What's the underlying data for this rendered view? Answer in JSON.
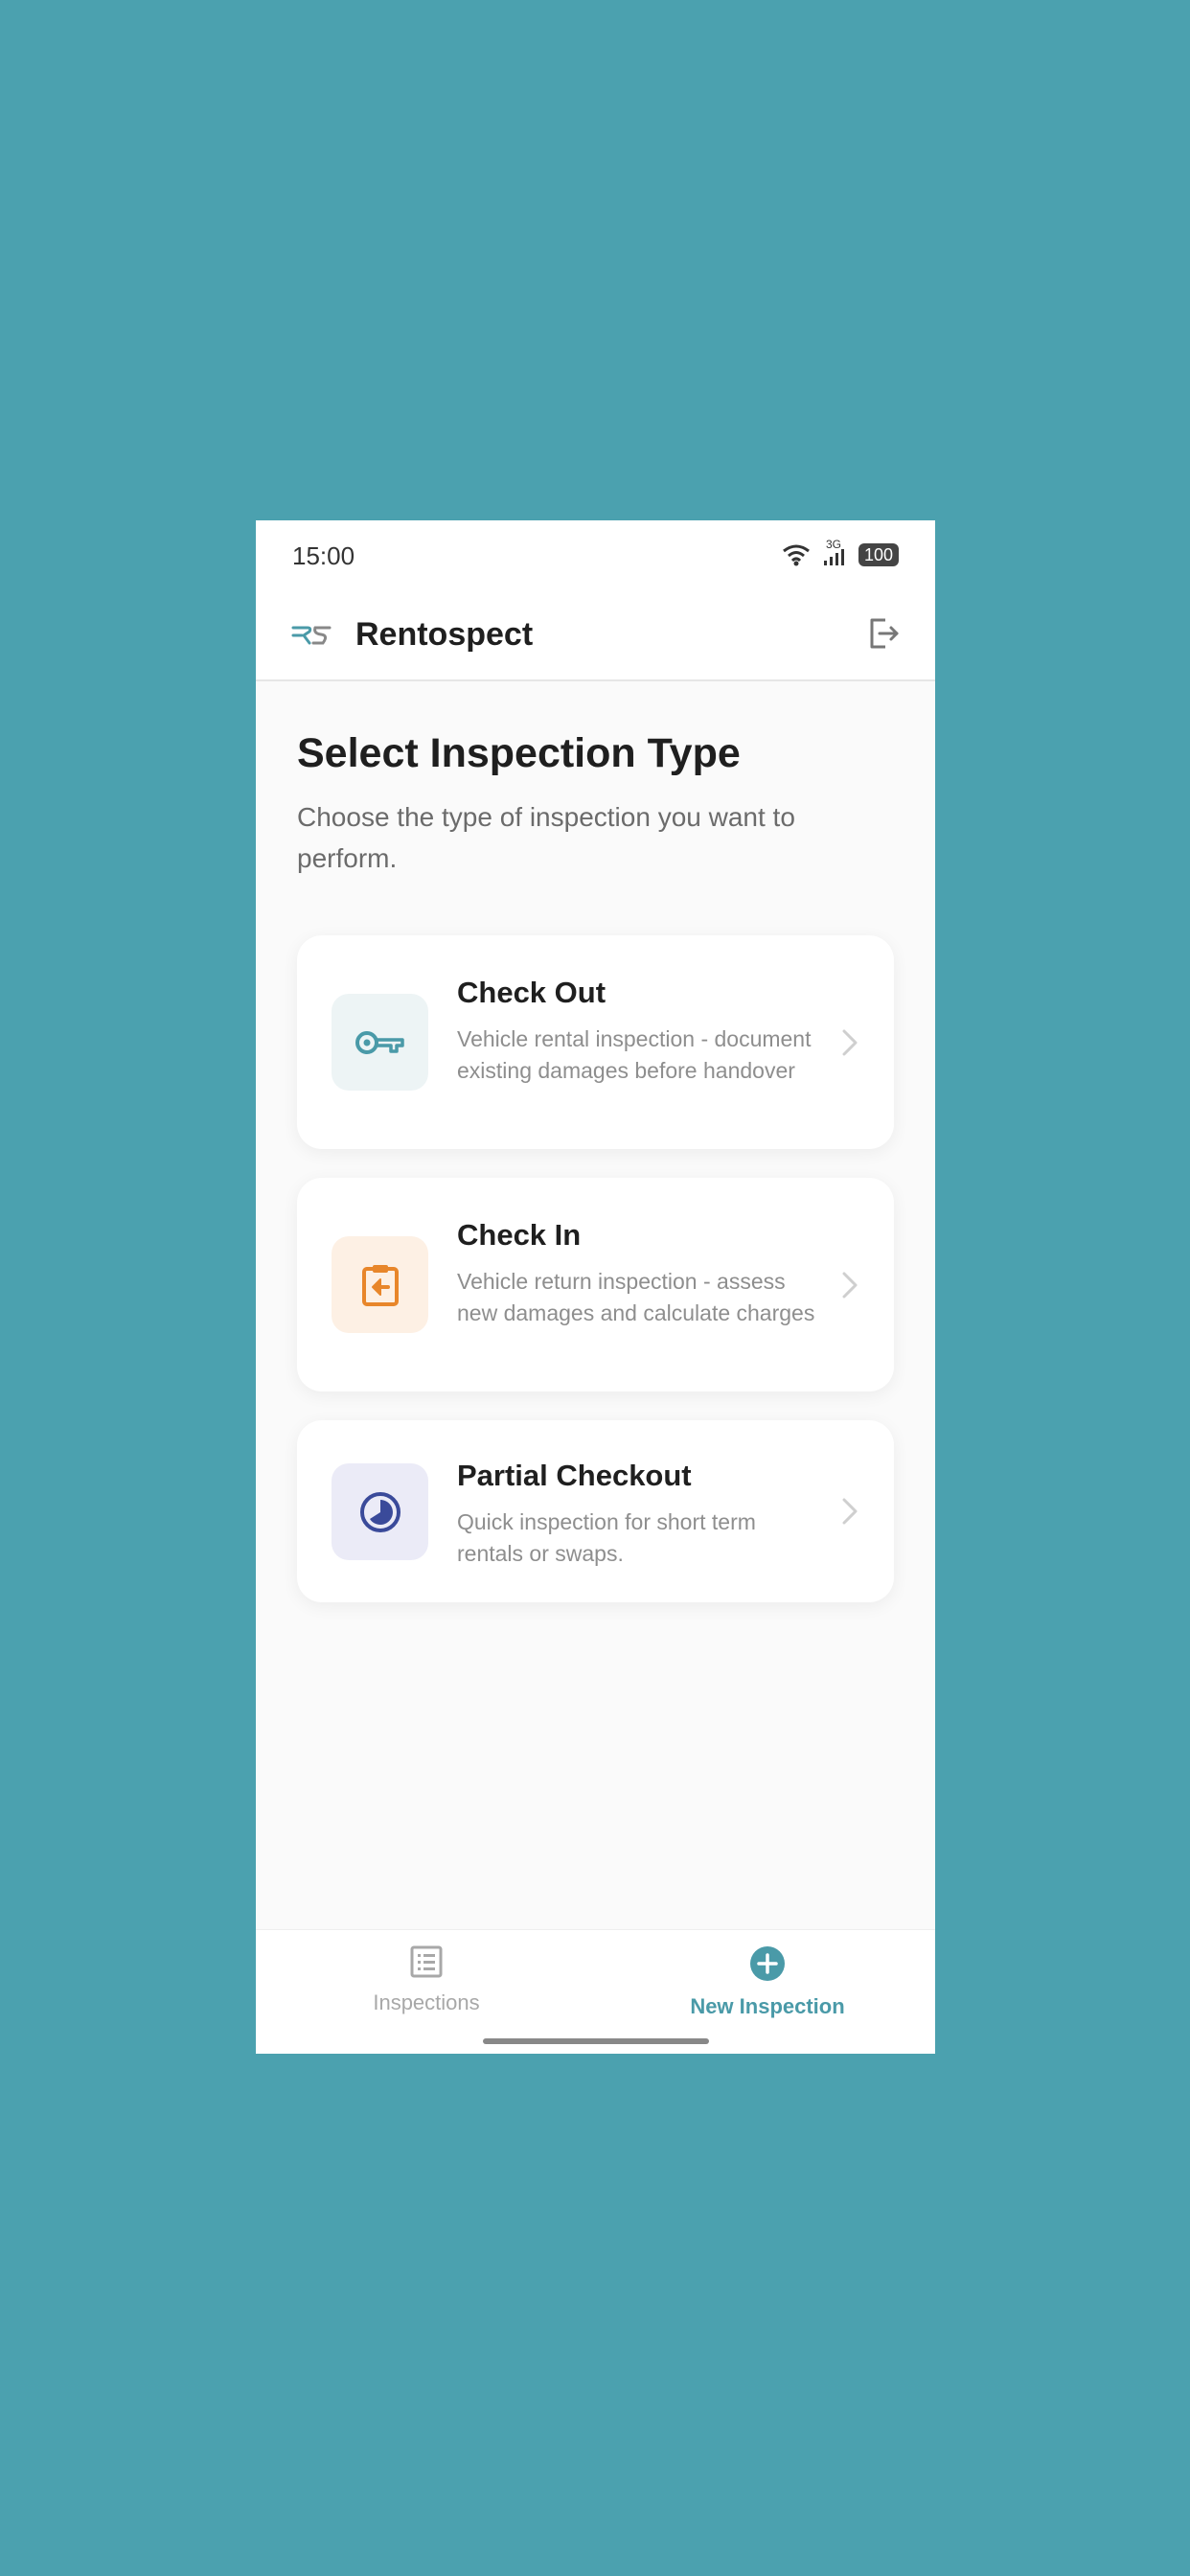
{
  "status_bar": {
    "time": "15:00",
    "network": "3G",
    "battery": "100"
  },
  "app_bar": {
    "title": "Rentospect",
    "logo_icon": "rentospect-logo-icon",
    "logout_icon": "logout-icon"
  },
  "page": {
    "title": "Select Inspection Type",
    "subtitle": "Choose the type of inspection you want to perform."
  },
  "inspection_types": [
    {
      "title": "Check Out",
      "description": "Vehicle rental inspection - document existing damages before handover",
      "icon": "key-icon",
      "icon_color": "#4a9aa8",
      "icon_bg": "#edf4f5"
    },
    {
      "title": "Check In",
      "description": "Vehicle return inspection - assess new damages and calculate charges",
      "icon": "clipboard-return-icon",
      "icon_color": "#e8862a",
      "icon_bg": "#fdf0e4"
    },
    {
      "title": "Partial Checkout",
      "description": "Quick inspection for short term rentals or swaps.",
      "icon": "half-circle-icon",
      "icon_color": "#3a4a9a",
      "icon_bg": "#ebebf7"
    }
  ],
  "bottom_nav": {
    "items": [
      {
        "label": "Inspections",
        "icon": "list-icon",
        "active": false
      },
      {
        "label": "New Inspection",
        "icon": "plus-circle-icon",
        "active": true
      }
    ]
  },
  "colors": {
    "background": "#4ba1af",
    "accent": "#4a9aa8",
    "inactive": "#a8a8a8"
  }
}
